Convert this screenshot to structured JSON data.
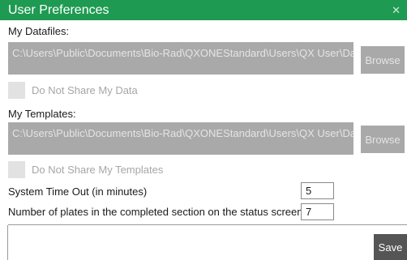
{
  "window": {
    "title": "User Preferences",
    "close_glyph": "✕"
  },
  "datafiles": {
    "label": "My Datafiles:",
    "path": "C:\\Users\\Public\\Documents\\Bio-Rad\\QXONEStandard\\Users\\QX User\\Data",
    "browse_label": "Browse",
    "share_label": "Do Not Share My Data",
    "share_checked": false
  },
  "templates": {
    "label": "My Templates:",
    "path": "C:\\Users\\Public\\Documents\\Bio-Rad\\QXONEStandard\\Users\\QX User\\Data",
    "browse_label": "Browse",
    "share_label": "Do Not Share My Templates",
    "share_checked": false
  },
  "timeout": {
    "label": "System Time Out (in minutes)",
    "value": "5"
  },
  "plates": {
    "label": "Number of plates in the completed section on the status screen",
    "value": "7"
  },
  "footer": {
    "save_label": "Save"
  },
  "colors": {
    "title_bar": "#1f9a52",
    "disabled_field": "#a9a9a9",
    "save_button": "#555555"
  }
}
